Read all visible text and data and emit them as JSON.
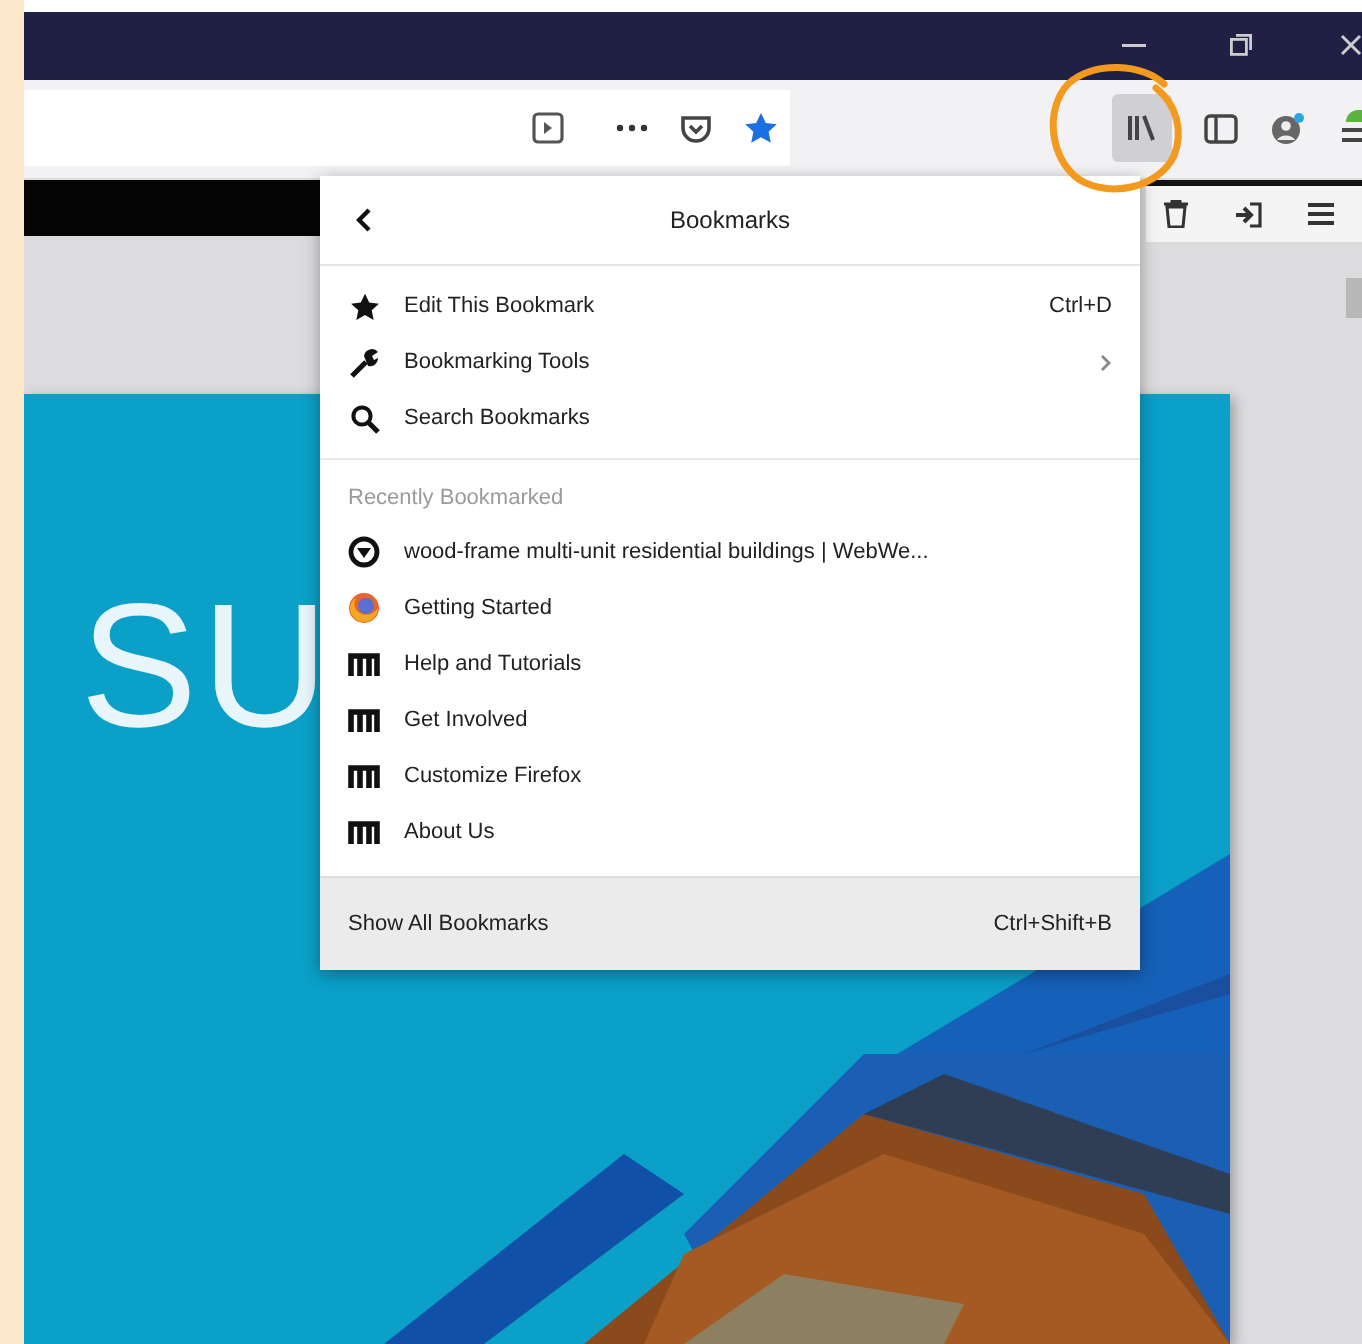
{
  "toolbar": {
    "bookmarked": true,
    "library_pressed": true
  },
  "menu": {
    "title": "Bookmarks",
    "actions": [
      {
        "kind": "star",
        "label": "Edit This Bookmark",
        "shortcut": "Ctrl+D",
        "submenu": false
      },
      {
        "kind": "wrench",
        "label": "Bookmarking Tools",
        "submenu": true
      },
      {
        "kind": "search",
        "label": "Search Bookmarks",
        "submenu": false
      }
    ],
    "section": "Recently Bookmarked",
    "bookmarks": [
      {
        "kind": "site",
        "label": "wood-frame multi-unit residential buildings | WebWe..."
      },
      {
        "kind": "firefox",
        "label": "Getting Started"
      },
      {
        "kind": "mozilla",
        "label": "Help and Tutorials"
      },
      {
        "kind": "mozilla",
        "label": "Get Involved"
      },
      {
        "kind": "mozilla",
        "label": "Customize Firefox"
      },
      {
        "kind": "mozilla",
        "label": "About Us"
      }
    ],
    "footer": {
      "label": "Show All Bookmarks",
      "shortcut": "Ctrl+Shift+B"
    }
  },
  "page": {
    "heading": "SU"
  }
}
